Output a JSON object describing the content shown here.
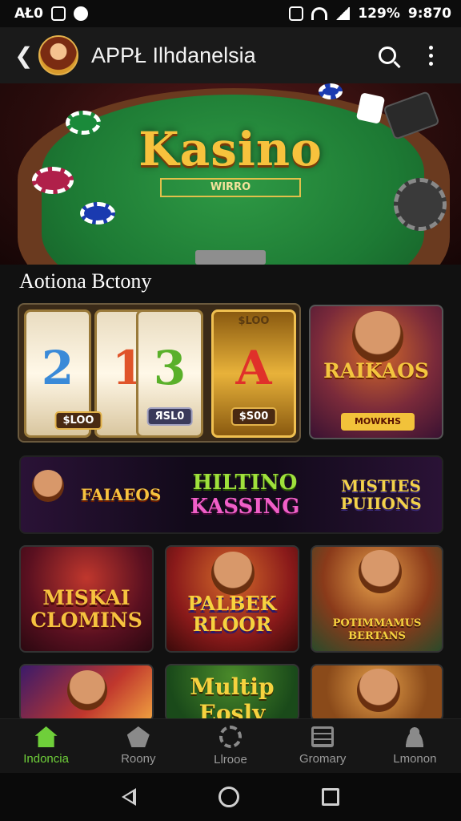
{
  "status_bar": {
    "left_text": "AŁ0",
    "battery": "129%",
    "time": "9:870"
  },
  "app_bar": {
    "title": "APPŁ Ilhdanelsia",
    "icons": [
      "back-icon",
      "avatar",
      "search-icon",
      "more-vert-icon"
    ]
  },
  "hero": {
    "title": "Kasino",
    "subtitle": "WIRRO"
  },
  "section": {
    "title": "Aotiona Bctony"
  },
  "slot_card": {
    "reels": [
      {
        "number": "2",
        "label": "",
        "color": "#3a8ad8"
      },
      {
        "number": "1",
        "label": "$LOO",
        "color": "#e0542a"
      },
      {
        "number": "3",
        "label": "ЯSL0",
        "color": "#5ab02a"
      },
      {
        "number": "A",
        "label": "$S00",
        "color": "#e0302a",
        "top": "$LOO"
      }
    ]
  },
  "promo_card": {
    "title": "RAIKAOS",
    "button": "MOWKHS"
  },
  "banner": {
    "item1": "FAIAEOS",
    "item2_line1": "HILTINO",
    "item2_line2": "KASSING",
    "item3": "MISTIES PUIIONS"
  },
  "tiles": [
    {
      "title": "MISKAI CLOMINS"
    },
    {
      "title": "PALBEK RLOOR"
    },
    {
      "title": "POTIMMAMUS BERTANS"
    }
  ],
  "bottom_tiles": [
    {
      "title": ""
    },
    {
      "title": "Multip Eosly"
    },
    {
      "title": ""
    }
  ],
  "bottom_nav": [
    {
      "label": "Indoncia",
      "icon": "home-icon",
      "active": true
    },
    {
      "label": "Roony",
      "icon": "star-icon",
      "active": false
    },
    {
      "label": "Llrooe",
      "icon": "gear-icon",
      "active": false
    },
    {
      "label": "Gromary",
      "icon": "grid-icon",
      "active": false
    },
    {
      "label": "Lmonon",
      "icon": "user-icon",
      "active": false
    }
  ],
  "colors": {
    "accent": "#6fcf3a",
    "gold": "#f6c23f",
    "felt": "#1d7a34"
  }
}
